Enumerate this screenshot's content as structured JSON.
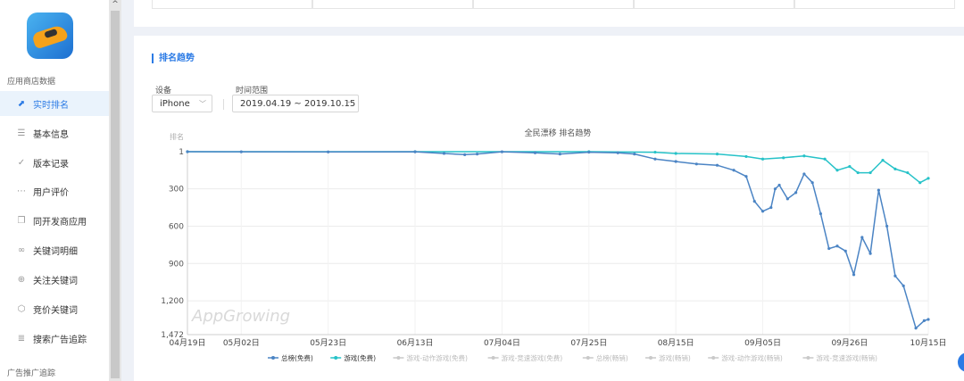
{
  "sidebar": {
    "section_title": "应用商店数据",
    "items": [
      {
        "label": "实时排名",
        "icon": "chart-line-icon",
        "glyph": "⬈",
        "active": true
      },
      {
        "label": "基本信息",
        "icon": "list-icon",
        "glyph": "☰",
        "active": false
      },
      {
        "label": "版本记录",
        "icon": "check-circle-icon",
        "glyph": "✓",
        "active": false
      },
      {
        "label": "用户评价",
        "icon": "comment-icon",
        "glyph": "⋯",
        "active": false
      },
      {
        "label": "同开发商应用",
        "icon": "copy-icon",
        "glyph": "❐",
        "active": false
      },
      {
        "label": "关键词明细",
        "icon": "link-icon",
        "glyph": "∞",
        "active": false
      },
      {
        "label": "关注关键词",
        "icon": "plus-circle-icon",
        "glyph": "⊕",
        "active": false
      },
      {
        "label": "竞价关键词",
        "icon": "box-icon",
        "glyph": "⬡",
        "active": false
      },
      {
        "label": "搜索广告追踪",
        "icon": "document-icon",
        "glyph": "≣",
        "active": false
      }
    ],
    "section2_title": "广告推广追踪"
  },
  "filters": {
    "section_title": "排名趋势",
    "device_label": "设备",
    "device_value": "iPhone",
    "range_label": "时间范围",
    "range_value": "2019.04.19 ~ 2019.10.15"
  },
  "chart_data": {
    "type": "line",
    "title": "全民漂移 排名趋势",
    "ylabel": "排名",
    "yaxis_reversed": true,
    "ylim": [
      1,
      1472
    ],
    "yticks": [
      1,
      300,
      600,
      900,
      1200,
      1472
    ],
    "ytick_labels": [
      "1",
      "300",
      "600",
      "900",
      "1,200",
      "1,472"
    ],
    "xlim": [
      "2019-04-19",
      "2019-10-15"
    ],
    "xticks": [
      "2019-04-19",
      "2019-05-02",
      "2019-05-23",
      "2019-06-13",
      "2019-07-04",
      "2019-07-25",
      "2019-08-15",
      "2019-09-05",
      "2019-09-26",
      "2019-10-15"
    ],
    "xtick_labels": [
      "04月19日",
      "05月02日",
      "05月23日",
      "06月13日",
      "07月04日",
      "07月25日",
      "08月15日",
      "09月05日",
      "09月26日",
      "10月15日"
    ],
    "series": [
      {
        "name": "总榜(免费)",
        "color": "#4b84c4",
        "visible": true,
        "points": [
          [
            "2019-04-19",
            1
          ],
          [
            "2019-05-02",
            2
          ],
          [
            "2019-05-23",
            3
          ],
          [
            "2019-06-13",
            2
          ],
          [
            "2019-06-20",
            15
          ],
          [
            "2019-06-25",
            25
          ],
          [
            "2019-06-28",
            20
          ],
          [
            "2019-07-04",
            2
          ],
          [
            "2019-07-12",
            10
          ],
          [
            "2019-07-18",
            20
          ],
          [
            "2019-07-25",
            5
          ],
          [
            "2019-08-01",
            10
          ],
          [
            "2019-08-05",
            20
          ],
          [
            "2019-08-10",
            60
          ],
          [
            "2019-08-15",
            80
          ],
          [
            "2019-08-20",
            100
          ],
          [
            "2019-08-25",
            110
          ],
          [
            "2019-08-29",
            150
          ],
          [
            "2019-09-01",
            200
          ],
          [
            "2019-09-03",
            400
          ],
          [
            "2019-09-05",
            480
          ],
          [
            "2019-09-07",
            450
          ],
          [
            "2019-09-08",
            300
          ],
          [
            "2019-09-09",
            270
          ],
          [
            "2019-09-11",
            380
          ],
          [
            "2019-09-13",
            330
          ],
          [
            "2019-09-15",
            180
          ],
          [
            "2019-09-17",
            250
          ],
          [
            "2019-09-19",
            500
          ],
          [
            "2019-09-21",
            780
          ],
          [
            "2019-09-23",
            760
          ],
          [
            "2019-09-25",
            800
          ],
          [
            "2019-09-27",
            990
          ],
          [
            "2019-09-29",
            690
          ],
          [
            "2019-10-01",
            820
          ],
          [
            "2019-10-03",
            310
          ],
          [
            "2019-10-05",
            600
          ],
          [
            "2019-10-07",
            1000
          ],
          [
            "2019-10-09",
            1080
          ],
          [
            "2019-10-12",
            1420
          ],
          [
            "2019-10-14",
            1360
          ],
          [
            "2019-10-15",
            1350
          ]
        ]
      },
      {
        "name": "游戏(免费)",
        "color": "#26c2c8",
        "visible": true,
        "points": [
          [
            "2019-04-19",
            1
          ],
          [
            "2019-06-13",
            1
          ],
          [
            "2019-07-25",
            1
          ],
          [
            "2019-08-10",
            5
          ],
          [
            "2019-08-15",
            15
          ],
          [
            "2019-08-25",
            20
          ],
          [
            "2019-09-01",
            40
          ],
          [
            "2019-09-05",
            60
          ],
          [
            "2019-09-10",
            50
          ],
          [
            "2019-09-15",
            35
          ],
          [
            "2019-09-20",
            60
          ],
          [
            "2019-09-23",
            150
          ],
          [
            "2019-09-26",
            120
          ],
          [
            "2019-09-28",
            170
          ],
          [
            "2019-10-01",
            170
          ],
          [
            "2019-10-04",
            70
          ],
          [
            "2019-10-07",
            140
          ],
          [
            "2019-10-10",
            170
          ],
          [
            "2019-10-13",
            250
          ],
          [
            "2019-10-15",
            215
          ]
        ]
      },
      {
        "name": "游戏-动作游戏(免费)",
        "color": "#c9c9c9",
        "visible": false
      },
      {
        "name": "游戏-竞速游戏(免费)",
        "color": "#c9c9c9",
        "visible": false
      },
      {
        "name": "总榜(畅销)",
        "color": "#c9c9c9",
        "visible": false
      },
      {
        "name": "游戏(畅销)",
        "color": "#c9c9c9",
        "visible": false
      },
      {
        "name": "游戏-动作游戏(畅销)",
        "color": "#c9c9c9",
        "visible": false
      },
      {
        "name": "游戏-竞速游戏(畅销)",
        "color": "#c9c9c9",
        "visible": false
      }
    ],
    "grid": true,
    "legend_position": "bottom",
    "watermark": "AppGrowing"
  }
}
